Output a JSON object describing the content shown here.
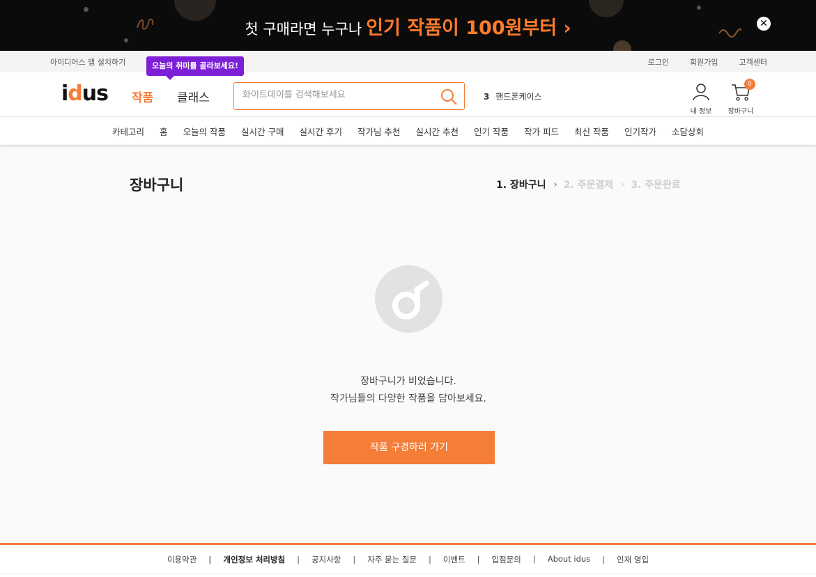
{
  "promo": {
    "text_plain": "첫 구매라면 누구나",
    "text_highlight": "인기 작품이 100원부터 ›",
    "close_symbol": "✕"
  },
  "utility": {
    "app_install": "아이디어스 앱 설치하기",
    "login": "로그인",
    "signup": "회원가입",
    "support": "고객센터"
  },
  "tooltip": "오늘의 취미를 골라보세요!",
  "header": {
    "logo_parts": [
      "i",
      "d",
      "us"
    ],
    "nav_works": "작품",
    "nav_classes": "클래스",
    "search_placeholder": "화이트데이를 검색해보세요",
    "rank_number": "3",
    "rank_keyword": "핸드폰케이스",
    "my_info": "내 정보",
    "cart": "장바구니",
    "cart_count": "0"
  },
  "category_nav": [
    "카테고리",
    "홈",
    "오늘의 작품",
    "실시간 구매",
    "실시간 후기",
    "작가님 추천",
    "실시간 추천",
    "인기 작품",
    "작가 피드",
    "최신 작품",
    "인기작가",
    "소담상회"
  ],
  "main": {
    "title": "장바구니",
    "steps": [
      "1. 장바구니",
      "2. 주문결제",
      "3. 주문완료"
    ],
    "step_separator": "›",
    "empty_line1": "장바구니가 비었습니다.",
    "empty_line2": "작가님들의 다양한 작품을 담아보세요.",
    "cta": "작품 구경하러 가기"
  },
  "footer": [
    {
      "label": "이용약관",
      "bold": false
    },
    {
      "label": "개인정보 처리방침",
      "bold": true
    },
    {
      "label": "공지사항",
      "bold": false
    },
    {
      "label": "자주 묻는 질문",
      "bold": false
    },
    {
      "label": "이벤트",
      "bold": false
    },
    {
      "label": "입점문의",
      "bold": false
    },
    {
      "label": "About idus",
      "bold": false
    },
    {
      "label": "인재 영입",
      "bold": false
    }
  ],
  "colors": {
    "accent": "#f47d38",
    "tooltip": "#7d1fd7",
    "banner_bg": "#0b0b0b"
  }
}
